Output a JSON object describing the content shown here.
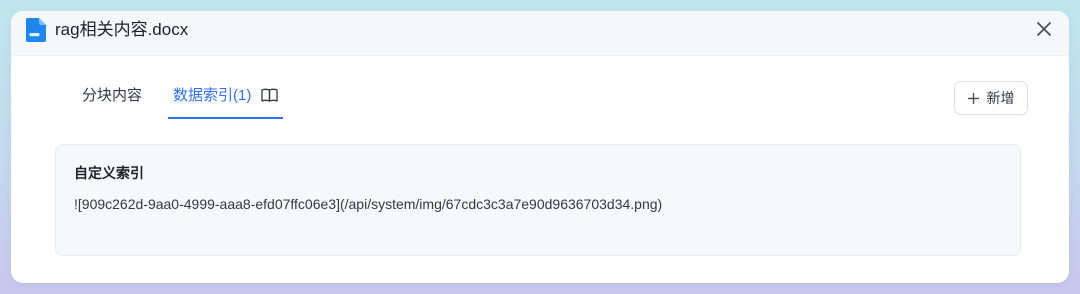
{
  "modal": {
    "title": "rag相关内容.docx",
    "file_icon": "docx-file-icon",
    "close_icon": "close-icon"
  },
  "tabs": [
    {
      "label": "分块内容",
      "active": false
    },
    {
      "label": "数据索引(1)",
      "active": true,
      "icon": "book-icon"
    }
  ],
  "actions": {
    "add_label": "新增",
    "add_icon": "plus-icon"
  },
  "index_card": {
    "title": "自定义索引",
    "content": "![909c262d-9aa0-4999-aaa8-efd07ffc06e3](/api/system/img/67cdc3c3a7e90d9636703d34.png)"
  },
  "colors": {
    "accent": "#3370ff",
    "file_icon": "#1e86ef",
    "card_bg": "#f7f8fa",
    "header_bg": "#f5f7fb"
  }
}
